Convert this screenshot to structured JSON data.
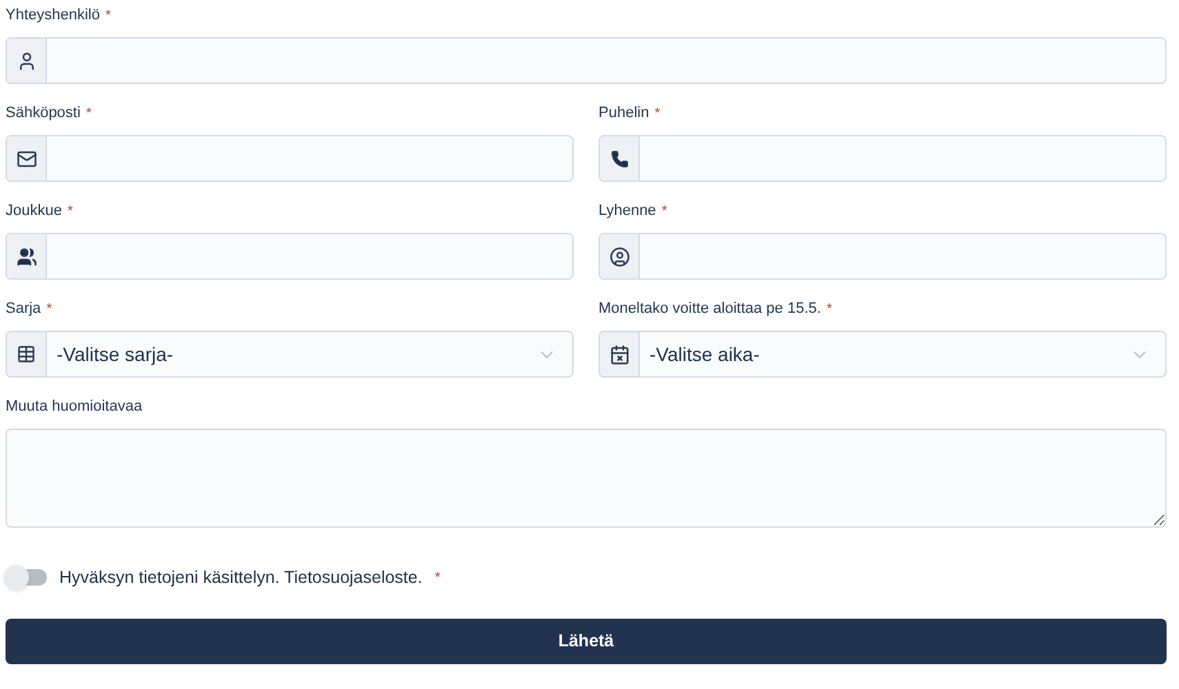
{
  "fields": [
    {
      "label": "Yhteyshenkilö",
      "required_mark": "*",
      "kind": "text"
    },
    {
      "label": "Sähköposti",
      "required_mark": "*",
      "kind": "text"
    },
    {
      "label": "Puhelin",
      "required_mark": "*",
      "kind": "text"
    },
    {
      "label": "Joukkue",
      "required_mark": "*",
      "kind": "text"
    },
    {
      "label": "Lyhenne",
      "required_mark": "*",
      "kind": "text"
    },
    {
      "label": "Sarja",
      "required_mark": "*",
      "kind": "select",
      "value": "-Valitse sarja-"
    },
    {
      "label": "Moneltako voitte aloittaa pe 15.5.",
      "required_mark": "*",
      "kind": "select",
      "value": "-Valitse aika-"
    },
    {
      "label": "Muuta huomioitavaa",
      "kind": "textarea"
    }
  ],
  "consent": {
    "text": "Hyväksyn tietojeni käsittelyn. Tietosuojaseloste.",
    "required_mark": "*",
    "on": false
  },
  "submit": {
    "label": "Lähetä"
  }
}
